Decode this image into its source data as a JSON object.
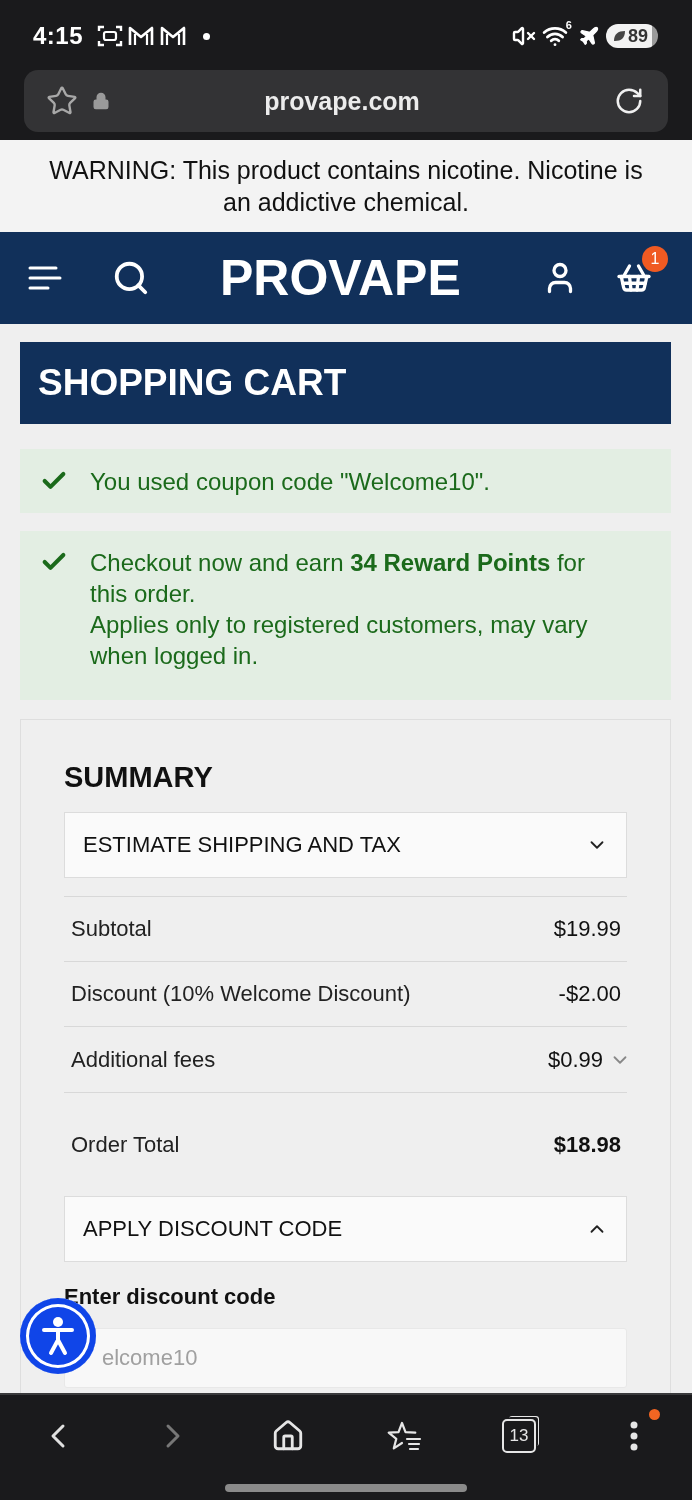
{
  "status_bar": {
    "time": "4:15",
    "wifi_label": "6",
    "battery": "89"
  },
  "browser": {
    "url": "provape.com"
  },
  "warning": "WARNING: This product contains nicotine. Nicotine is an addictive chemical.",
  "header": {
    "logo": "PROVAPE",
    "cart_count": "1"
  },
  "page_title": "SHOPPING CART",
  "messages": [
    {
      "kind": "success",
      "lines": [
        "You used coupon code \"Welcome10\"."
      ]
    },
    {
      "kind": "success",
      "lines": [
        "Checkout now and earn **34 Reward Points** for this order.",
        "Applies only to registered customers, may vary when logged in."
      ]
    }
  ],
  "summary": {
    "title": "SUMMARY",
    "shipping": {
      "title": "ESTIMATE SHIPPING AND TAX",
      "expanded": false
    },
    "rows": [
      {
        "kind": "amount",
        "label": "Subtotal",
        "value": "$19.99"
      },
      {
        "kind": "amount",
        "label": "Discount (10% Welcome Discount)",
        "value": "-$2.00"
      },
      {
        "kind": "toggle",
        "label": "Additional fees",
        "value": "$0.99",
        "expanded": false
      }
    ],
    "total": {
      "label": "Order Total",
      "value": "$18.98"
    },
    "discount": {
      "title": "APPLY DISCOUNT CODE",
      "expanded": true,
      "field_label": "Enter discount code",
      "placeholder": "elcome10"
    }
  },
  "bottom_nav": {
    "tabs_count": "13"
  }
}
